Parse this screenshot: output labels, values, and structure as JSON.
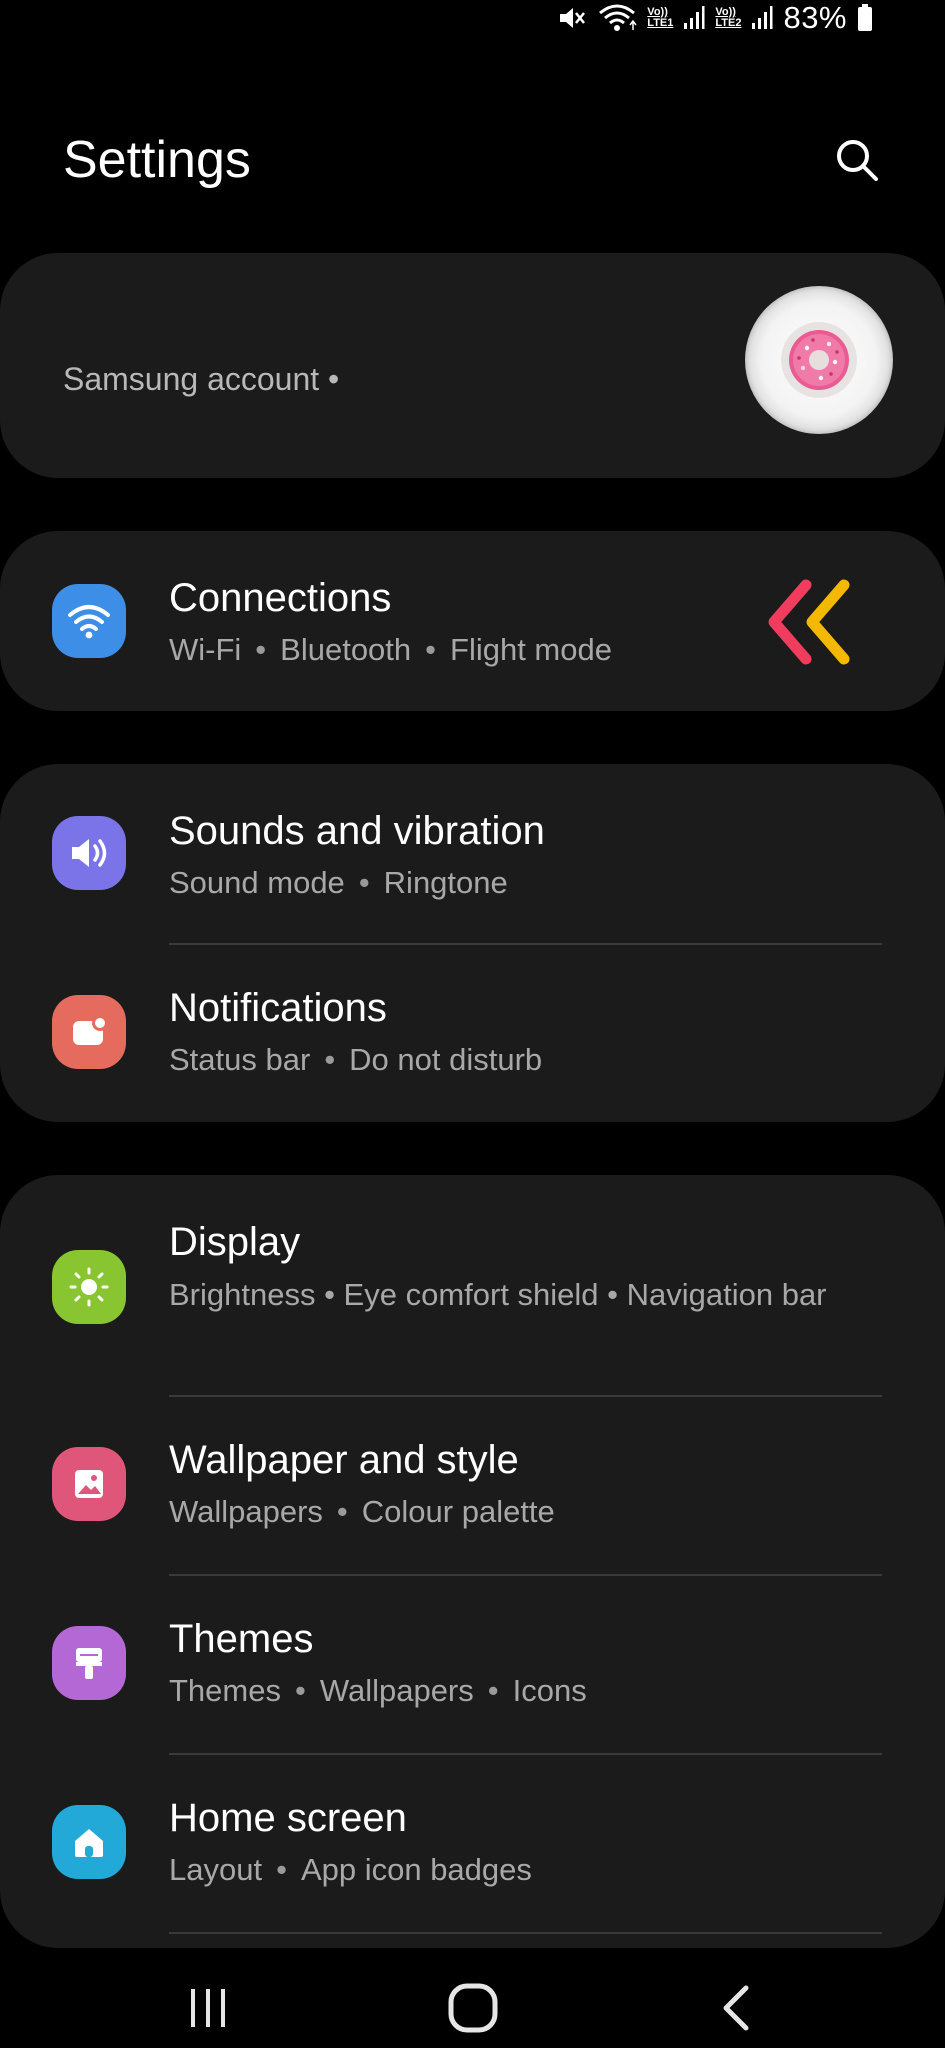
{
  "status_bar": {
    "network_1": [
      "Vo))",
      "LTE1"
    ],
    "network_2": [
      "Vo))",
      "LTE2"
    ],
    "battery": "83%",
    "icons": [
      "mute-icon",
      "wifi-icon",
      "signal-icon",
      "signal-icon",
      "battery-icon"
    ]
  },
  "header": {
    "title": "Settings",
    "search_icon": "search-icon"
  },
  "account": {
    "label": "Samsung account  •"
  },
  "groups": [
    {
      "items": [
        {
          "title": "Connections",
          "subtitle": [
            "Wi-Fi",
            "Bluetooth",
            "Flight mode"
          ],
          "icon": "wifi-icon",
          "icon_color": "#3d8ee6"
        }
      ]
    },
    {
      "items": [
        {
          "title": "Sounds and vibration",
          "subtitle": [
            "Sound mode",
            "Ringtone"
          ],
          "icon": "speaker-icon",
          "icon_color": "#7b74e8"
        },
        {
          "title": "Notifications",
          "subtitle": [
            "Status bar",
            "Do not disturb"
          ],
          "icon": "notification-icon",
          "icon_color": "#e56b5e"
        }
      ]
    },
    {
      "items": [
        {
          "title": "Display",
          "subtitle_text": "Brightness  •  Eye comfort shield  •  Navigation bar",
          "icon": "brightness-icon",
          "icon_color": "#88c531"
        },
        {
          "title": "Wallpaper and style",
          "subtitle": [
            "Wallpapers",
            "Colour palette"
          ],
          "icon": "wallpaper-icon",
          "icon_color": "#e0567a"
        },
        {
          "title": "Themes",
          "subtitle": [
            "Themes",
            "Wallpapers",
            "Icons"
          ],
          "icon": "themes-icon",
          "icon_color": "#b468d6"
        },
        {
          "title": "Home screen",
          "subtitle": [
            "Layout",
            "App icon badges"
          ],
          "icon": "home-icon",
          "icon_color": "#23a9d8"
        }
      ]
    }
  ],
  "annotation": {
    "icon": "double-chevron-left-icon",
    "colors": [
      "#f03d5e",
      "#f5b800"
    ]
  },
  "nav_bar": {
    "icons": [
      "recents-icon",
      "home-button-icon",
      "back-icon"
    ]
  }
}
